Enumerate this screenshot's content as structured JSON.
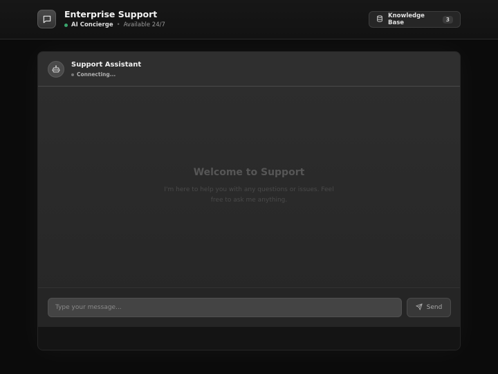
{
  "header": {
    "title": "Enterprise Support",
    "concierge_label": "AI Concierge",
    "separator": "•",
    "availability": "Available 24/7",
    "app_icon": "chat-bubble-icon",
    "knowledge_base": {
      "label": "Knowledge Base",
      "count": "3",
      "icon": "database-icon"
    }
  },
  "chat": {
    "assistant_name": "Support Assistant",
    "status": "Connecting...",
    "avatar_icon": "robot-icon",
    "welcome": {
      "title": "Welcome to Support",
      "text": "I'm here to help you with any questions or issues. Feel free to ask me anything."
    },
    "input": {
      "placeholder": "Type your message...",
      "value": ""
    },
    "send": {
      "label": "Send",
      "icon": "send-icon"
    }
  },
  "colors": {
    "online": "#3aa56d",
    "connecting": "#777777",
    "background": "#0b0b0b"
  }
}
